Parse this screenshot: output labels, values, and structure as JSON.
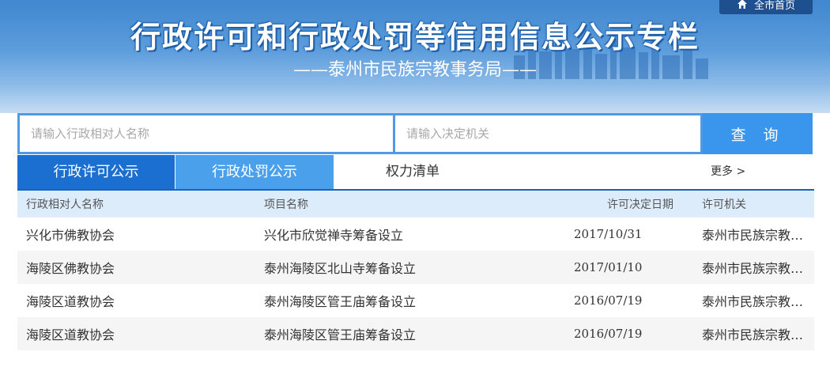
{
  "banner": {
    "title": "行政许可和行政处罚等信用信息公示专栏",
    "subtitle": "——泰州市民族宗教事务局——",
    "home_label": "全市首页"
  },
  "search": {
    "name_placeholder": "请输入行政相对人名称",
    "authority_placeholder": "请输入决定机关",
    "button_label": "查 询"
  },
  "tabs": [
    {
      "label": "行政许可公示"
    },
    {
      "label": "行政处罚公示"
    },
    {
      "label": "权力清单"
    }
  ],
  "more_label": "更多 >",
  "table": {
    "headers": [
      "行政相对人名称",
      "项目名称",
      "许可决定日期",
      "许可机关"
    ],
    "rows": [
      [
        "兴化市佛教协会",
        "兴化市欣觉禅寺筹备设立",
        "2017/10/31",
        "泰州市民族宗教事务局"
      ],
      [
        "海陵区佛教协会",
        "泰州海陵区北山寺筹备设立",
        "2017/01/10",
        "泰州市民族宗教事务局"
      ],
      [
        "海陵区道教协会",
        "泰州海陵区管王庙筹备设立",
        "2016/07/19",
        "泰州市民族宗教事务局"
      ],
      [
        "海陵区道教协会",
        "泰州海陵区管王庙筹备设立",
        "2016/07/19",
        "泰州市民族宗教事务局"
      ]
    ]
  },
  "colors": {
    "active_tab": "#1a6fd0",
    "secondary_tab": "#4aa0ea",
    "search_button": "#3a95ec",
    "header_row": "#dcecfb"
  }
}
